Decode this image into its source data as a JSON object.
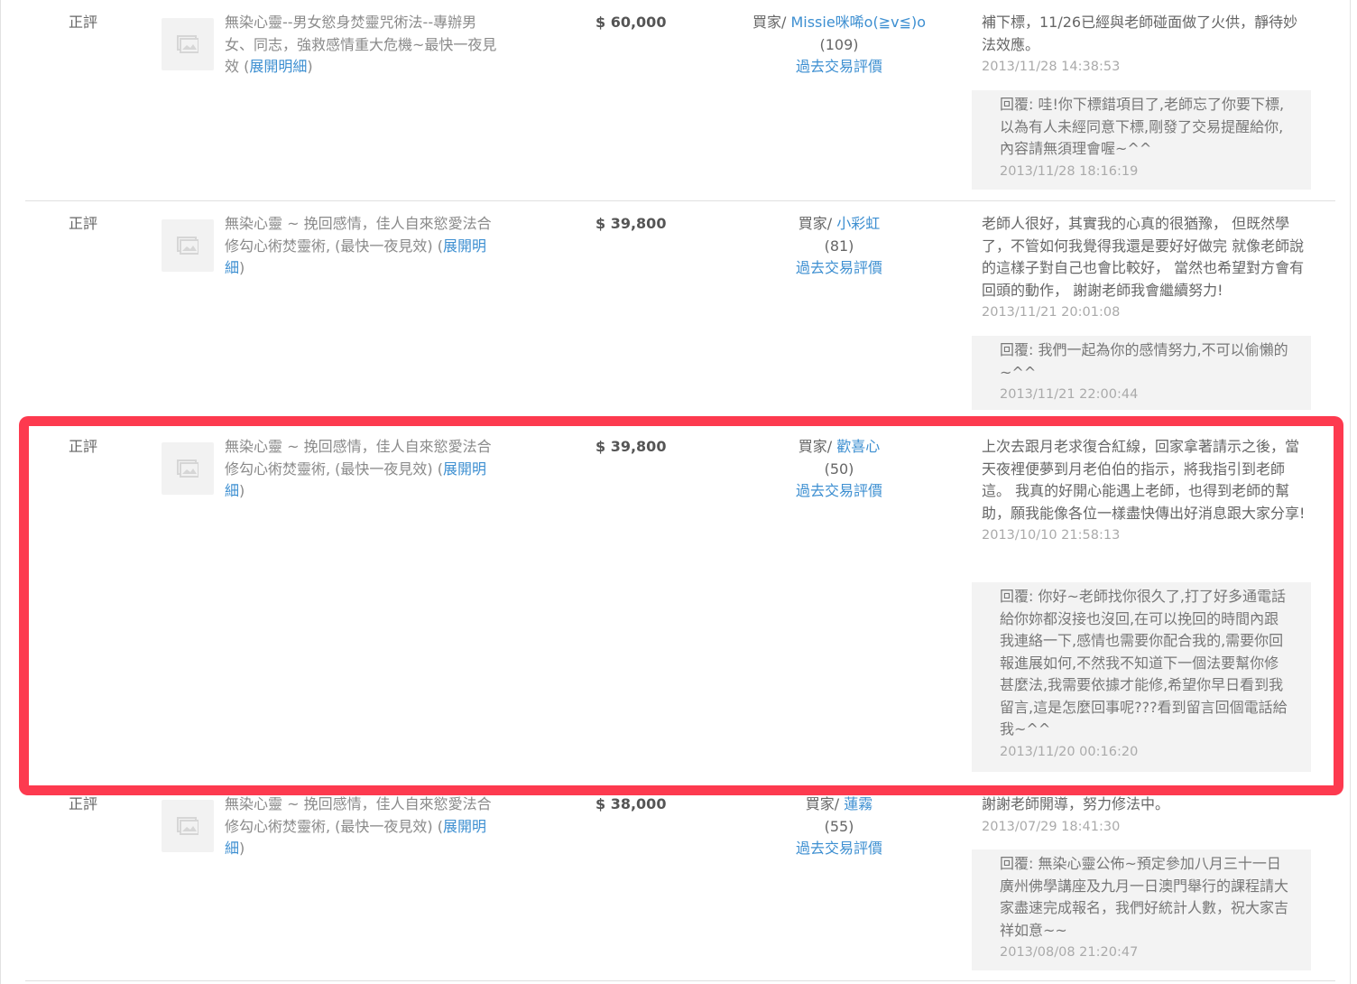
{
  "rows": [
    {
      "rating": "正評",
      "item_text": "無染心靈--男女慾身焚靈咒術法--專辦男女、同志，強救感情重大危機~最快一夜見效 (",
      "item_link": "展開明細",
      "item_close": ")",
      "price": "$ 60,000",
      "buyer_prefix": "買家/ ",
      "buyer_name": "Missie咪唏o(≧v≦)o",
      "buyer_score": "(109)",
      "history_link": "過去交易評價",
      "comment": "補下標，11/26已經與老師碰面做了火供，靜待妙法效應。",
      "comment_date": "2013/11/28 14:38:53",
      "reply": "回覆: 哇!你下標錯項目了,老師忘了你要下標,以為有人未經同意下標,剛發了交易提醒給你,內容請無須理會喔~^^",
      "reply_date": "2013/11/28 18:16:19"
    },
    {
      "rating": "正評",
      "item_text": "無染心靈 ~ 挽回感情，佳人自來慾愛法合修勾心術焚靈術, (最快一夜見效) (",
      "item_link": "展開明細",
      "item_close": ")",
      "price": "$ 39,800",
      "buyer_prefix": "買家/ ",
      "buyer_name": "小彩虹",
      "buyer_score": "(81)",
      "history_link": "過去交易評價",
      "comment": "老師人很好，其實我的心真的很猶豫， 但既然學了，不管如何我覺得我還是要好好做完 就像老師說的這樣子對自己也會比較好， 當然也希望對方會有回頭的動作， 謝謝老師我會繼續努力!",
      "comment_date": "2013/11/21 20:01:08",
      "reply": "回覆: 我們一起為你的感情努力,不可以偷懶的~^^",
      "reply_date": "2013/11/21 22:00:44"
    },
    {
      "rating": "正評",
      "item_text": "無染心靈 ~ 挽回感情，佳人自來慾愛法合修勾心術焚靈術, (最快一夜見效) (",
      "item_link": "展開明細",
      "item_close": ")",
      "price": "$ 39,800",
      "buyer_prefix": "買家/ ",
      "buyer_name": "歡喜心",
      "buyer_score": "(50)",
      "history_link": "過去交易評價",
      "comment": "上次去跟月老求復合紅線，回家拿著請示之後，當天夜裡便夢到月老伯伯的指示，將我指引到老師這。 我真的好開心能遇上老師，也得到老師的幫助，願我能像各位一樣盡快傳出好消息跟大家分享!",
      "comment_date": "2013/10/10 21:58:13",
      "reply": "回覆: 你好~老師找你很久了,打了好多通電話給你妳都沒接也沒回,在可以挽回的時間內跟我連絡一下,感情也需要你配合我的,需要你回報進展如何,不然我不知道下一個法要幫你修甚麼法,我需要依據才能修,希望你早日看到我留言,這是怎麼回事呢???看到留言回個電話給我~^^",
      "reply_date": "2013/11/20 00:16:20"
    },
    {
      "rating": "正評",
      "item_text": "無染心靈 ~ 挽回感情，佳人自來慾愛法合修勾心術焚靈術, (最快一夜見效) (",
      "item_link": "展開明細",
      "item_close": ")",
      "price": "$ 38,000",
      "buyer_prefix": "買家/ ",
      "buyer_name": "蓮霧",
      "buyer_score": "(55)",
      "history_link": "過去交易評價",
      "comment": "謝謝老師開導，努力修法中。",
      "comment_date": "2013/07/29 18:41:30",
      "reply": "回覆: 無染心靈公佈~預定參加八月三十一日廣州佛學講座及九月一日澳門舉行的課程請大家盡速完成報名，我們好統計人數，祝大家吉祥如意~~",
      "reply_date": "2013/08/08 21:20:47"
    }
  ],
  "colors": {
    "link": "#3d8fd1",
    "highlight": "#fd3a4f",
    "reply_bg": "#f3f3f3"
  },
  "icons": {
    "thumbnail": "image-placeholder-icon"
  }
}
